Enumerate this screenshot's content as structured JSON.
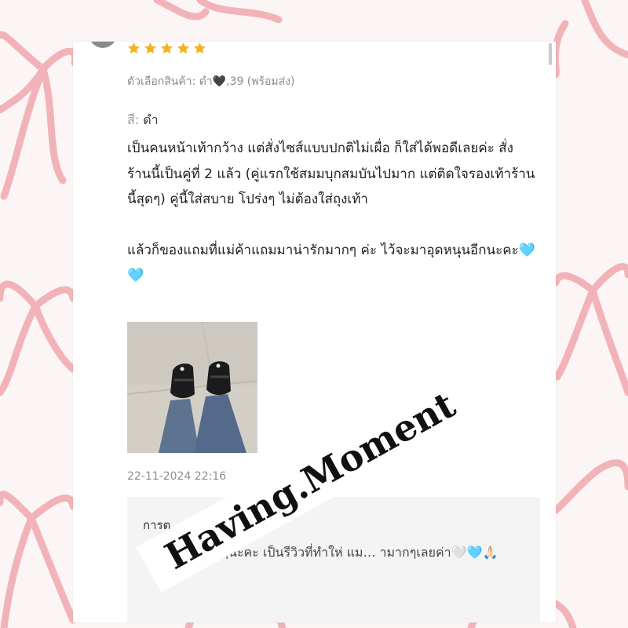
{
  "review": {
    "rating": 5,
    "variant": "ตัวเลือกสินค้า: ดำ🖤,39 (พร้อมส่ง)",
    "color_label": "สี:",
    "color_value": "ดำ",
    "paragraph1": "เป็นคนหน้าเท้ากว้าง แต่สั่งไซส์แบบปกติไม่เผื่อ ก็ใส่ได้พอดีเลยค่ะ สั่งร้านนี้เป็นคู่ที่ 2 แล้ว (คู่แรกใช้สมมบุกสมบันไปมาก แต่ติดใจรองเท้าร้านนี้สุดๆ) คู่นี้ใส่สบาย โปร่งๆ ไม่ต้องใส่ถุงเท้า",
    "paragraph2": "แล้วก็ของแถมที่แม่ค้าแถมมาน่ารักมากๆ ค่ะ ไว้จะมาอุดหนุนอีกนะคะ🩵🩵",
    "timestamp": "22-11-2024 22:16"
  },
  "seller_reply": {
    "title": "การต",
    "text": "ข… ลูกค้ามากๆนะคะ เป็นรีวิวที่ทำให่ แม… ามากๆเลยค่า🤍🩵🙏🏻"
  },
  "watermark": "Having.Moment",
  "colors": {
    "star": "#f6b21b",
    "ribbon": "#f2b3b8",
    "reply_bg": "#f4f4f4"
  }
}
